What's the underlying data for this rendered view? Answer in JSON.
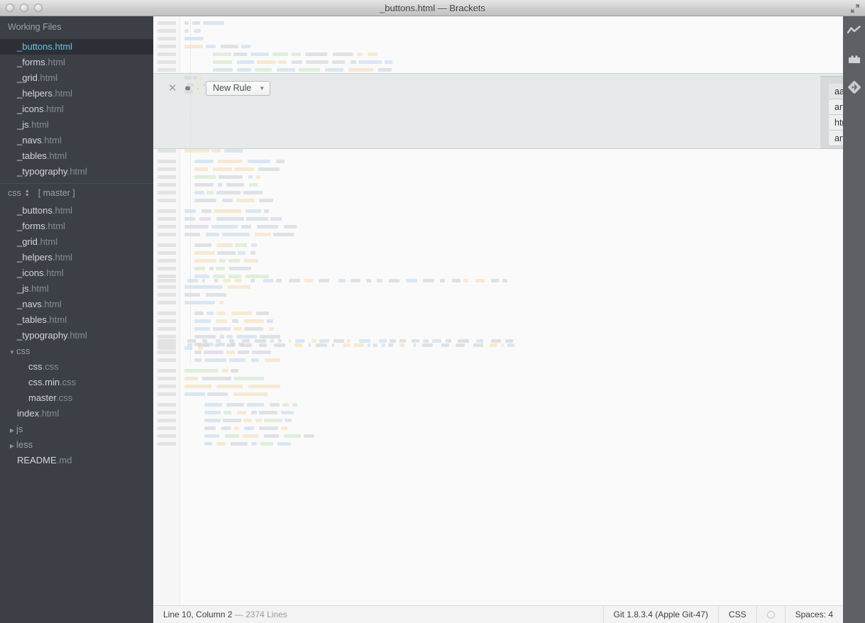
{
  "window": {
    "title": "_buttons.html — Brackets",
    "traffic_lights": [
      "close",
      "minimize",
      "zoom"
    ],
    "expand_icon": "expand-arrows-icon"
  },
  "sidebar": {
    "working_files_header": "Working Files",
    "working_files": [
      {
        "base": "_buttons",
        "ext": ".html",
        "active": true
      },
      {
        "base": "_forms",
        "ext": ".html",
        "active": false
      },
      {
        "base": "_grid",
        "ext": ".html",
        "active": false
      },
      {
        "base": "_helpers",
        "ext": ".html",
        "active": false
      },
      {
        "base": "_icons",
        "ext": ".html",
        "active": false
      },
      {
        "base": "_js",
        "ext": ".html",
        "active": false
      },
      {
        "base": "_navs",
        "ext": ".html",
        "active": false
      },
      {
        "base": "_tables",
        "ext": ".html",
        "active": false
      },
      {
        "base": "_typography",
        "ext": ".html",
        "active": false
      }
    ],
    "project": {
      "name": "css",
      "branch": "[ master ]",
      "sort_icon": "sort-updown-icon"
    },
    "tree": [
      {
        "kind": "file",
        "base": "_buttons",
        "ext": ".html",
        "indent": 0
      },
      {
        "kind": "file",
        "base": "_forms",
        "ext": ".html",
        "indent": 0
      },
      {
        "kind": "file",
        "base": "_grid",
        "ext": ".html",
        "indent": 0
      },
      {
        "kind": "file",
        "base": "_helpers",
        "ext": ".html",
        "indent": 0
      },
      {
        "kind": "file",
        "base": "_icons",
        "ext": ".html",
        "indent": 0
      },
      {
        "kind": "file",
        "base": "_js",
        "ext": ".html",
        "indent": 0
      },
      {
        "kind": "file",
        "base": "_navs",
        "ext": ".html",
        "indent": 0
      },
      {
        "kind": "file",
        "base": "_tables",
        "ext": ".html",
        "indent": 0
      },
      {
        "kind": "file",
        "base": "_typography",
        "ext": ".html",
        "indent": 0
      },
      {
        "kind": "dir",
        "base": "css",
        "ext": "",
        "indent": 0,
        "expanded": true
      },
      {
        "kind": "file",
        "base": "css",
        "ext": ".css",
        "indent": 1
      },
      {
        "kind": "file",
        "base": "css.min",
        "ext": ".css",
        "indent": 1
      },
      {
        "kind": "file",
        "base": "master",
        "ext": ".css",
        "indent": 1
      },
      {
        "kind": "file",
        "base": "index",
        "ext": ".html",
        "indent": 0
      },
      {
        "kind": "dir",
        "base": "js",
        "ext": "",
        "indent": 0,
        "expanded": false
      },
      {
        "kind": "dir",
        "base": "less",
        "ext": "",
        "indent": 0,
        "expanded": false
      },
      {
        "kind": "file",
        "base": "README",
        "ext": ".md",
        "indent": 0
      }
    ]
  },
  "inline_editor": {
    "close_icon": "close-icon",
    "dirty_icon": "dirty-dot-icon",
    "separator": "·",
    "new_rule_label": "New Rule",
    "new_rule_caret": "dropdown-caret-icon"
  },
  "rule_list": {
    "rules": [
      {
        "selector": "aa, abbr, acronym, address, article, aside, au…",
        "selected": true
      },
      {
        "selector": "article, aside, details, figcaption, figure, foot…",
        "selected": false
      },
      {
        "selector": "html,body,div,span,object,iframe,p,blockq…",
        "selected": false
      },
      {
        "selector": "article,aside,details,figcaption,figure,footer…",
        "selected": false
      }
    ]
  },
  "toolbar": {
    "items": [
      {
        "icon": "live-preview-bolt-icon",
        "label": "Live Preview"
      },
      {
        "icon": "extension-manager-icon",
        "label": "Extension Manager"
      },
      {
        "icon": "git-diamond-icon",
        "label": "Git"
      }
    ]
  },
  "statusbar": {
    "cursor": "Line 10, Column 2",
    "dash": "—",
    "line_count": "2374 Lines",
    "git_version": "Git 1.8.3.4 (Apple Git-47)",
    "language": "CSS",
    "indicator_icon": "status-circle-icon",
    "indent": "Spaces:  4"
  },
  "colors": {
    "sidebar_bg": "#3c4046",
    "sidebar_active_bg": "#2c3034",
    "active_file_text": "#6fc0e8",
    "editor_bg": "#fafafa",
    "inline_editor_bg": "#e7eaea",
    "rule_list_bg": "#d7dada",
    "toolbar_bg": "#5d6165",
    "statusbar_bg": "#f3f3f3"
  }
}
